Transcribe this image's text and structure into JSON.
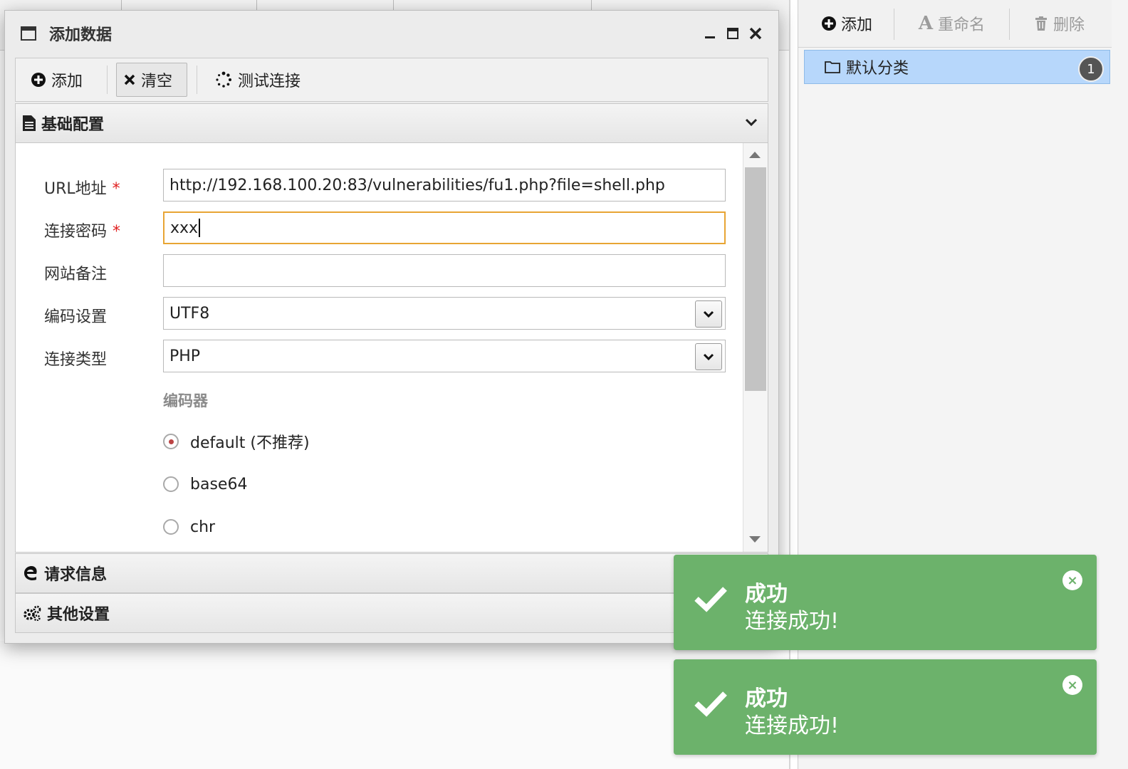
{
  "dialog": {
    "title": "添加数据",
    "toolbar": {
      "add": "添加",
      "clear": "清空",
      "test": "测试连接"
    }
  },
  "sections": {
    "basic": "基础配置",
    "request": "请求信息",
    "other": "其他设置"
  },
  "form": {
    "url_label": "URL地址",
    "url_value": "http://192.168.100.20:83/vulnerabilities/fu1.php?file=shell.php",
    "password_label": "连接密码",
    "password_value": "xxx",
    "note_label": "网站备注",
    "note_value": "",
    "encoding_label": "编码设置",
    "encoding_value": "UTF8",
    "type_label": "连接类型",
    "type_value": "PHP",
    "required_mark": "*",
    "encoder_label": "编码器",
    "encoders": [
      "default (不推荐)",
      "base64",
      "chr"
    ],
    "encoder_selected": "default (不推荐)"
  },
  "right_panel": {
    "toolbar": {
      "add": "添加",
      "rename": "重命名",
      "delete": "删除"
    },
    "category": {
      "name": "默认分类",
      "count": "1"
    }
  },
  "toasts": [
    {
      "title": "成功",
      "message": "连接成功!"
    },
    {
      "title": "成功",
      "message": "连接成功!"
    }
  ],
  "colors": {
    "toast_bg": "#6cb26b",
    "selected_row": "#b7d7fb",
    "focus_border": "#e8a534",
    "required": "#e02020"
  }
}
